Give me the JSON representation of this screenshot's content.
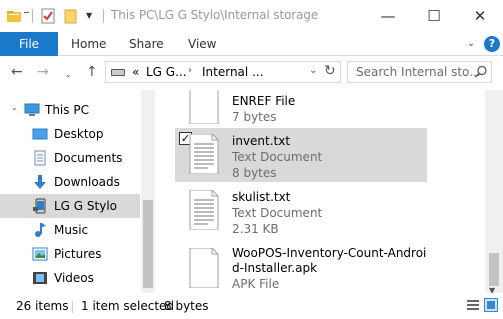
{
  "window": {
    "title": "This PC\\LG G Stylo\\Internal storage",
    "controls": {
      "minimize": "—",
      "maximize": "☐",
      "close": "✕"
    }
  },
  "ribbon": {
    "tabs": [
      {
        "label": "File"
      },
      {
        "label": "Home"
      },
      {
        "label": "Share"
      },
      {
        "label": "View"
      }
    ]
  },
  "address": {
    "overflow": "«",
    "segments": [
      "LG G...",
      "Internal ..."
    ],
    "search_placeholder": "Search Internal sto..."
  },
  "nav_pane": {
    "items": [
      {
        "label": "This PC",
        "icon": "computer-icon"
      },
      {
        "label": "Desktop",
        "icon": "desktop-icon"
      },
      {
        "label": "Documents",
        "icon": "documents-icon"
      },
      {
        "label": "Downloads",
        "icon": "downloads-icon"
      },
      {
        "label": "LG G Stylo",
        "icon": "phone-icon",
        "selected": true
      },
      {
        "label": "Music",
        "icon": "music-icon"
      },
      {
        "label": "Pictures",
        "icon": "pictures-icon"
      },
      {
        "label": "Videos",
        "icon": "videos-icon"
      }
    ]
  },
  "files": [
    {
      "name": "ENREF File",
      "type": "",
      "size": "7 bytes"
    },
    {
      "name": "invent.txt",
      "type": "Text Document",
      "size": "8 bytes",
      "selected": true,
      "checked": true
    },
    {
      "name": "skulist.txt",
      "type": "Text Document",
      "size": "2.31 KB"
    },
    {
      "name": "WooPOS-Inventory-Count-Androi",
      "name2": "d-Installer.apk",
      "type": "APK File"
    }
  ],
  "status": {
    "item_count": "26 items",
    "selection": "1 item selected",
    "selection_size": "8 bytes"
  },
  "colors": {
    "accent": "#1979ca",
    "selection": "#d9d9d9",
    "meta_text": "#6d6d6d"
  }
}
